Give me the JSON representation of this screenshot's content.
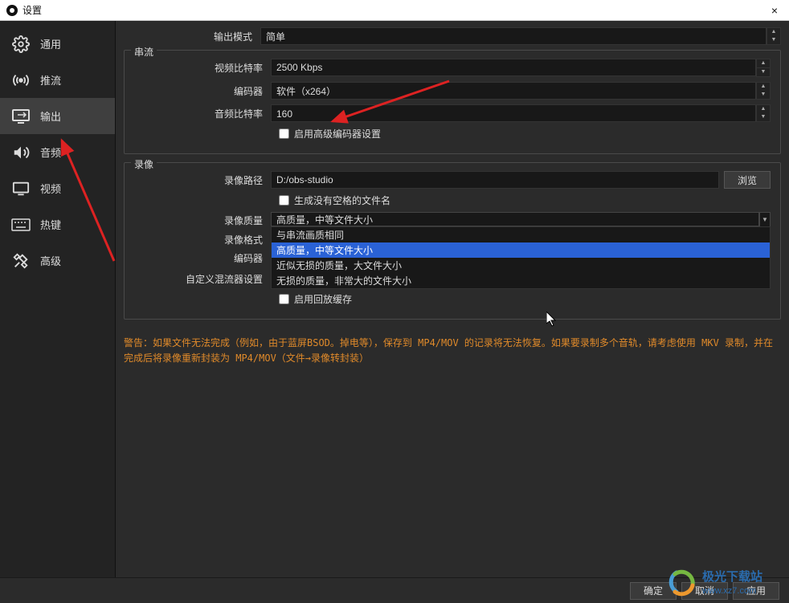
{
  "window": {
    "title": "设置",
    "close": "×"
  },
  "sidebar": {
    "items": [
      {
        "label": "通用"
      },
      {
        "label": "推流"
      },
      {
        "label": "输出"
      },
      {
        "label": "音频"
      },
      {
        "label": "视频"
      },
      {
        "label": "热键"
      },
      {
        "label": "高级"
      }
    ]
  },
  "output_mode": {
    "label": "输出模式",
    "value": "简单"
  },
  "stream": {
    "title": "串流",
    "video_bitrate_label": "视频比特率",
    "video_bitrate_value": "2500 Kbps",
    "encoder_label": "编码器",
    "encoder_value": "软件（x264）",
    "audio_bitrate_label": "音频比特率",
    "audio_bitrate_value": "160",
    "enable_adv_label": "启用高级编码器设置"
  },
  "recording": {
    "title": "录像",
    "path_label": "录像路径",
    "path_value": "D:/obs-studio",
    "browse_label": "浏览",
    "nospace_label": "生成没有空格的文件名",
    "quality_label": "录像质量",
    "quality_value": "高质量，中等文件大小",
    "quality_options": [
      "与串流画质相同",
      "高质量，中等文件大小",
      "近似无损的质量，大文件大小",
      "无损的质量，非常大的文件大小"
    ],
    "format_label": "录像格式",
    "encoder_label": "编码器",
    "mux_label": "自定义混流器设置",
    "replay_label": "启用回放缓存"
  },
  "warning_text": "警告：如果文件无法完成（例如，由于蓝屏BSOD。掉电等），保存到 MP4/MOV 的记录将无法恢复。如果要录制多个音轨，请考虑使用 MKV 录制，并在完成后将录像重新封装为 MP4/MOV（文件→录像转封装）",
  "footer": {
    "ok": "确定",
    "cancel": "取消",
    "apply": "应用"
  },
  "watermark": {
    "line1": "极光下载站",
    "line2": "www.xz7.com"
  }
}
